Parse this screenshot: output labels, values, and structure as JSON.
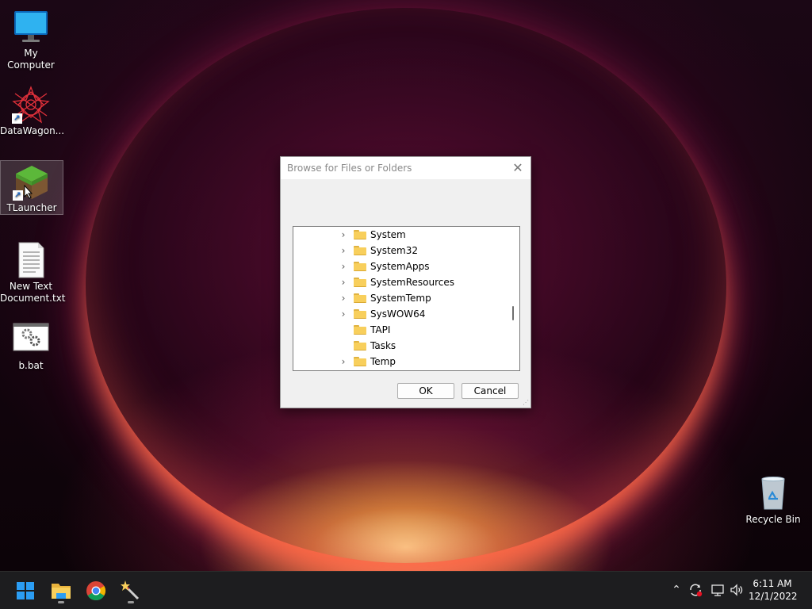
{
  "desktop": {
    "icons": [
      {
        "label": "My Computer"
      },
      {
        "label": "DataWagon..."
      },
      {
        "label": "TLauncher"
      },
      {
        "label": "New Text Document.txt"
      },
      {
        "label": "b.bat"
      },
      {
        "label": "Recycle Bin"
      }
    ]
  },
  "dialog": {
    "title": "Browse for Files or Folders",
    "close_glyph": "✕",
    "folders": [
      {
        "name": "System",
        "expandable": true
      },
      {
        "name": "System32",
        "expandable": true
      },
      {
        "name": "SystemApps",
        "expandable": true
      },
      {
        "name": "SystemResources",
        "expandable": true
      },
      {
        "name": "SystemTemp",
        "expandable": true
      },
      {
        "name": "SysWOW64",
        "expandable": true
      },
      {
        "name": "TAPI",
        "expandable": false
      },
      {
        "name": "Tasks",
        "expandable": false
      },
      {
        "name": "Temp",
        "expandable": true
      }
    ],
    "ok_label": "OK",
    "cancel_label": "Cancel"
  },
  "taskbar": {
    "apps": [
      "windows-start-icon",
      "file-explorer-icon",
      "chrome-icon",
      "magic-wand-app-icon"
    ],
    "tray": [
      "chevron-up-icon",
      "sync-alert-icon",
      "network-icon",
      "volume-icon"
    ],
    "time": "6:11 AM",
    "date": "12/1/2022"
  },
  "colors": {
    "folder": "#f8cf5c",
    "taskbar": "#1d1d1f",
    "start_blue": "#2b9df3"
  }
}
